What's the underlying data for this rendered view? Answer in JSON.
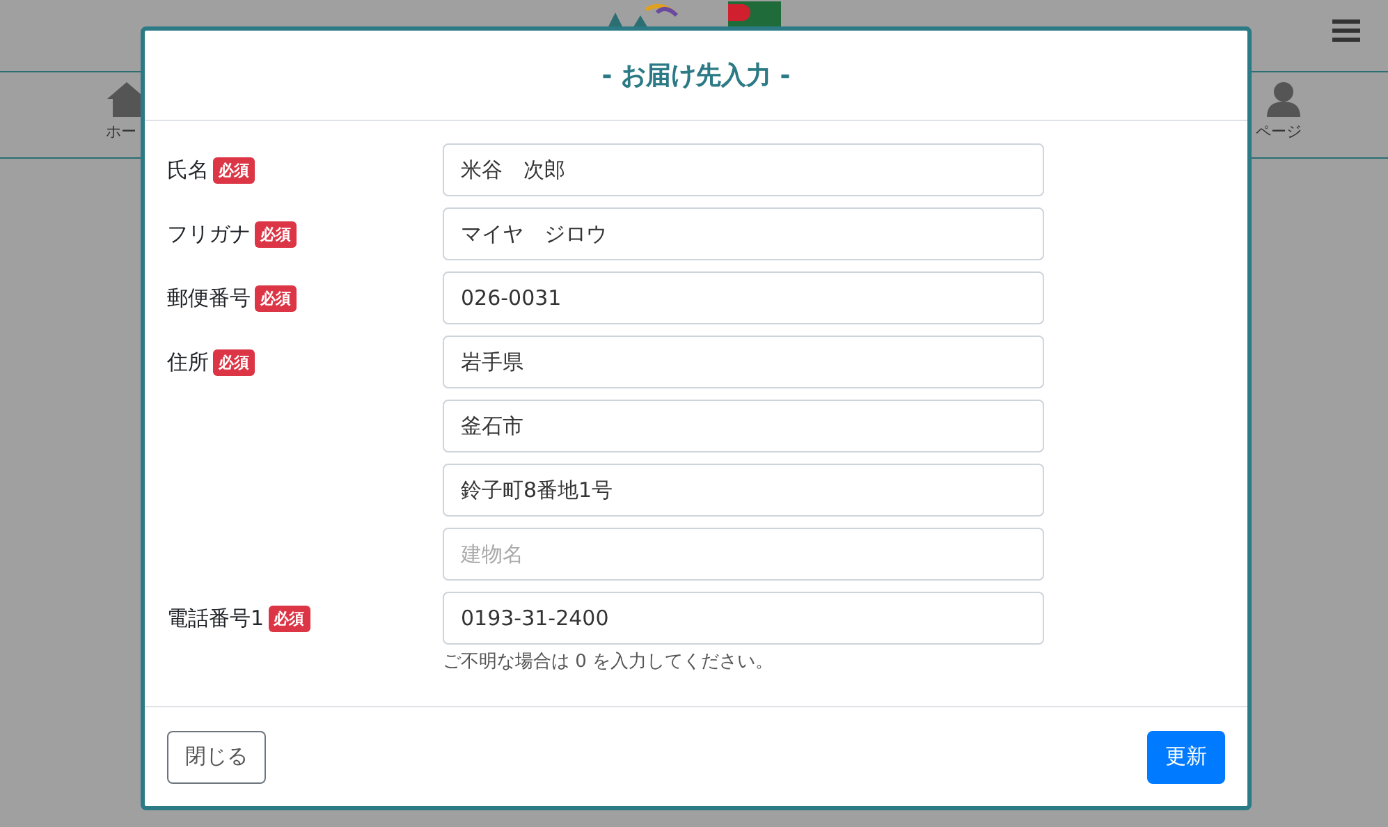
{
  "nav": {
    "left_label": "ホー",
    "right_label": "ページ"
  },
  "dialog": {
    "title": "- お届け先入力 -",
    "fields": [
      {
        "label": "氏名",
        "required": true,
        "badge": "必須",
        "inputs": [
          {
            "value": "米谷　次郎"
          }
        ]
      },
      {
        "label": "フリガナ",
        "required": true,
        "badge": "必須",
        "inputs": [
          {
            "value": "マイヤ　ジロウ"
          }
        ]
      },
      {
        "label": "郵便番号",
        "required": true,
        "badge": "必須",
        "inputs": [
          {
            "value": "026-0031"
          }
        ]
      },
      {
        "label": "住所",
        "required": true,
        "badge": "必須",
        "inputs": [
          {
            "value": "岩手県"
          },
          {
            "value": "釜石市"
          },
          {
            "value": "鈴子町8番地1号"
          },
          {
            "placeholder": "建物名"
          }
        ]
      },
      {
        "label": "電話番号1",
        "required": true,
        "badge": "必須",
        "inputs": [
          {
            "value": "0193-31-2400"
          }
        ],
        "help": "ご不明な場合は 0 を入力してください。"
      }
    ],
    "buttons": [
      {
        "label": "閉じる",
        "kind": "secondary"
      },
      {
        "label": "更新",
        "kind": "primary"
      }
    ]
  }
}
